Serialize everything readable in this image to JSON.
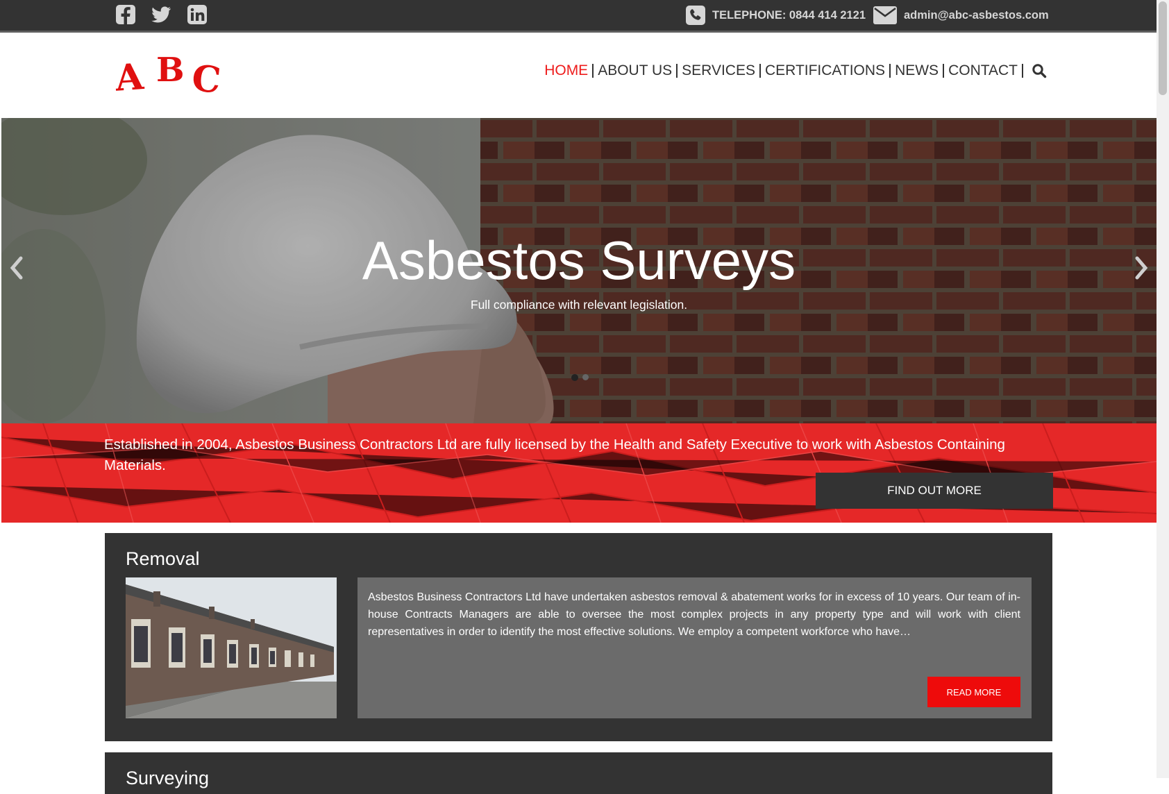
{
  "topbar": {
    "social": [
      {
        "name": "facebook-icon"
      },
      {
        "name": "twitter-icon"
      },
      {
        "name": "linkedin-icon"
      }
    ],
    "telephone": "TELEPHONE: 0844 414 2121",
    "email": "admin@abc-asbestos.com"
  },
  "header": {
    "logo_text": "A B C",
    "logo_color": "#e01010",
    "nav": [
      "HOME",
      "ABOUT US",
      "SERVICES",
      "CERTIFICATIONS",
      "NEWS",
      "CONTACT"
    ],
    "active_nav": "HOME",
    "accent_color": "#ee1c1c"
  },
  "hero": {
    "title": "Asbestos Surveys",
    "subtitle": "Full compliance with relevant legislation.",
    "slide_count": 2,
    "active_slide": 1
  },
  "band": {
    "text": "Established in 2004, Asbestos Business Contractors Ltd are fully licensed by the Health and Safety Executive to work with Asbestos Containing Materials.",
    "button": "FIND OUT MORE"
  },
  "services": [
    {
      "title": "Removal",
      "text": "Asbestos Business Contractors Ltd have undertaken asbestos removal & abatement works for in excess of 10 years. Our team of in-house Contracts Managers are able to oversee the most complex projects in any property type and will work with client representatives in order to identify the most effective solutions. We employ a competent workforce who have…",
      "button": "READ MORE"
    },
    {
      "title": "Surveying"
    }
  ]
}
